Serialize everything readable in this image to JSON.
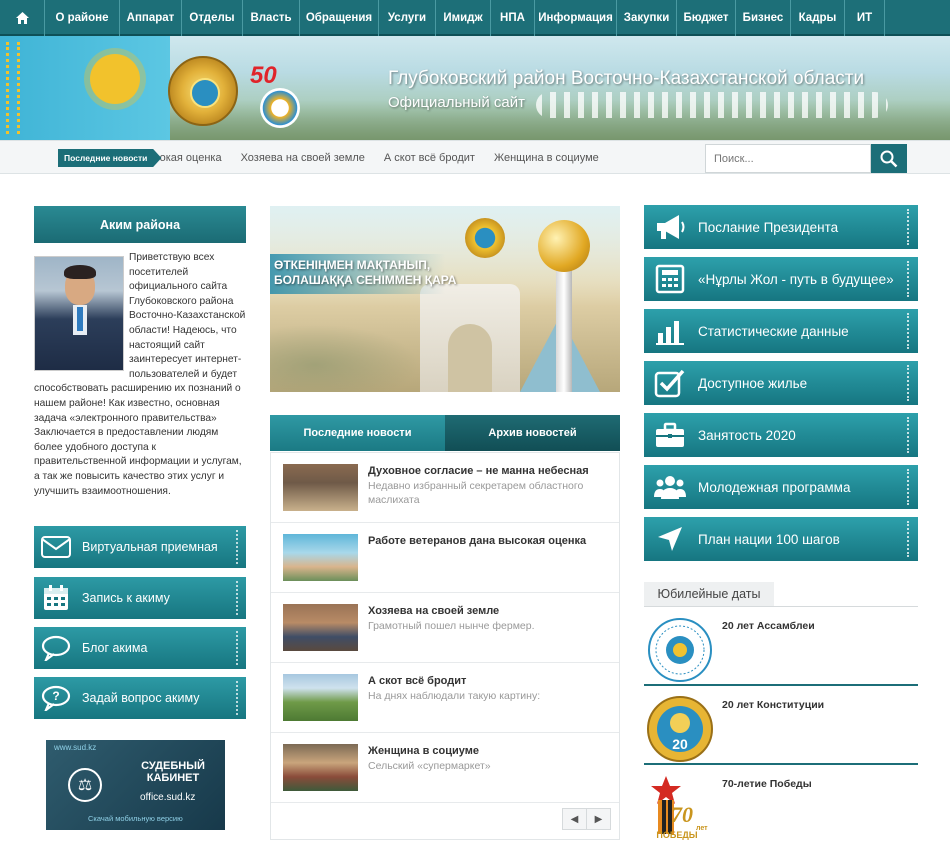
{
  "nav": {
    "items": [
      "О районе",
      "Аппарат",
      "Отделы",
      "Власть",
      "Обращения",
      "Услуги",
      "Имидж",
      "НПА",
      "Информация",
      "Закупки",
      "Бюджет",
      "Бизнес",
      "Кадры",
      "ИТ"
    ]
  },
  "banner": {
    "title": "Глубоковский район Восточно-Казахстанской области",
    "subtitle": "Официальный сайт",
    "anniversary_number": "50"
  },
  "ticker": {
    "label": "Последние новости",
    "items": [
      "сокая оценка",
      "Хозяева на своей земле",
      "А скот всё бродит",
      "Женщина в социуме"
    ],
    "search_placeholder": "Поиск..."
  },
  "akim": {
    "heading": "Аким района",
    "text": "Приветствую всех посетителей официального сайта Глубоковского района Восточно-Казахстанской области! Надеюсь, что настоящий сайт заинтересует интернет-пользователей и будет способствовать расширению их познаний о нашем районе! Как известно, основная задача «электронного правительства» Заключается в предоставлении людям более удобного доступа к правительственной информации и услугам, а так же повысить качество этих услуг и улучшить взаимоотношения."
  },
  "left_buttons": [
    {
      "label": "Виртуальная приемная",
      "icon": "envelope-icon"
    },
    {
      "label": "Запись к акиму",
      "icon": "calendar-icon"
    },
    {
      "label": "Блог акима",
      "icon": "chat-bubble-icon"
    },
    {
      "label": "Задай вопрос акиму",
      "icon": "question-bubble-icon"
    }
  ],
  "court_banner": {
    "url": "www.sud.kz",
    "title": "СУДЕБНЫЙ КАБИНЕТ",
    "site": "office.sud.kz",
    "footer": "Скачай мобильную версию"
  },
  "hero": {
    "slogan_line1": "ӨТКЕНІҢМЕН МАҚТАНЫП,",
    "slogan_line2": "БОЛАШАҚҚА СЕНІММЕН ҚАРА"
  },
  "news_tabs": {
    "latest": "Последние новости",
    "archive": "Архив новостей"
  },
  "news": [
    {
      "title": "Духовное согласие – не манна небесная",
      "desc": "Недавно избранный секретарем областного маслихата"
    },
    {
      "title": "Работе ветеранов дана высокая оценка",
      "desc": ""
    },
    {
      "title": "Хозяева на своей земле",
      "desc": "Грамотный пошел нынче фермер."
    },
    {
      "title": "А скот всё бродит",
      "desc": "На днях наблюдали такую картину:"
    },
    {
      "title": "Женщина в социуме",
      "desc": "Сельский «супермаркет»"
    }
  ],
  "pager": {
    "prev": "◀",
    "next": "▶"
  },
  "right_buttons": [
    {
      "label": "Послание Президента",
      "icon": "megaphone-icon"
    },
    {
      "label": "«Нұрлы Жол - путь в будущее»",
      "icon": "calculator-icon"
    },
    {
      "label": "Статистические данные",
      "icon": "bar-chart-icon"
    },
    {
      "label": "Доступное жилье",
      "icon": "checkbox-icon"
    },
    {
      "label": "Занятость 2020",
      "icon": "briefcase-icon"
    },
    {
      "label": "Молодежная программа",
      "icon": "people-icon"
    },
    {
      "label": "План нации 100 шагов",
      "icon": "navigation-arrow-icon"
    }
  ],
  "jubilee": {
    "heading": "Юбилейные даты",
    "items": [
      {
        "title": "20 лет Ассамблеи"
      },
      {
        "title": "20 лет Конституции"
      },
      {
        "title": "70-летие Победы",
        "badge_number": "70",
        "badge_line1": "лет",
        "badge_line2": "ПОБЕДЫ"
      }
    ]
  },
  "colors": {
    "teal_dark": "#1c6e78",
    "teal": "#2a8a93",
    "accent_red": "#e0242a"
  }
}
